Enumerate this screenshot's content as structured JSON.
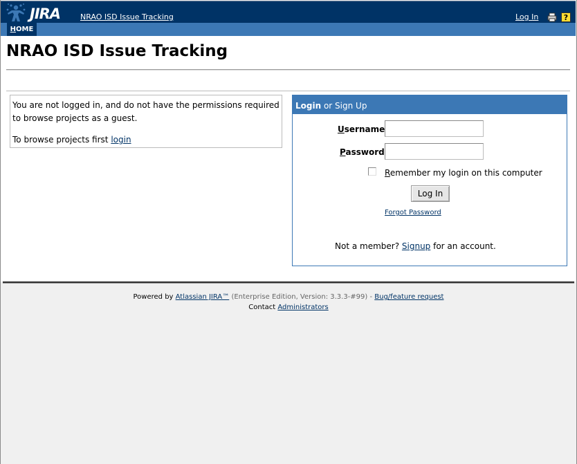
{
  "header": {
    "logo_text": "JIRA",
    "site_link": "NRAO ISD Issue Tracking",
    "login_link": "Log In",
    "icons": [
      "print-icon",
      "help-icon"
    ]
  },
  "nav": {
    "home_first": "H",
    "home_rest": "OME"
  },
  "page": {
    "title": "NRAO ISD Issue Tracking"
  },
  "guest": {
    "message": "You are not logged in, and do not have the permissions required to browse projects as a guest.",
    "browse_prefix": "To browse projects first ",
    "browse_link": "login"
  },
  "login": {
    "heading_bold": "Login",
    "heading_rest": " or Sign Up",
    "username_first": "U",
    "username_rest": "sername",
    "password_first": "P",
    "password_rest": "assword",
    "username_value": "",
    "password_value": "",
    "remember_first": "R",
    "remember_rest": "emember my login on this computer",
    "remember_checked": false,
    "button": "Log In",
    "forgot": "Forgot Password",
    "member_prefix": "Not a member? ",
    "signup_link": "Signup",
    "member_suffix": " for an account."
  },
  "footer": {
    "powered_prefix": "Powered by ",
    "product_link": "Atlassian JIRA™",
    "edition": " (Enterprise Edition, Version: 3.3.3-#99) - ",
    "bug_link": "Bug/feature request",
    "contact_prefix": "Contact ",
    "admin_link": "Administrators"
  },
  "colors": {
    "header_bg": "#003366",
    "nav_bg": "#3c78b5",
    "link": "#003366",
    "page_bg": "#f0f0f0"
  }
}
